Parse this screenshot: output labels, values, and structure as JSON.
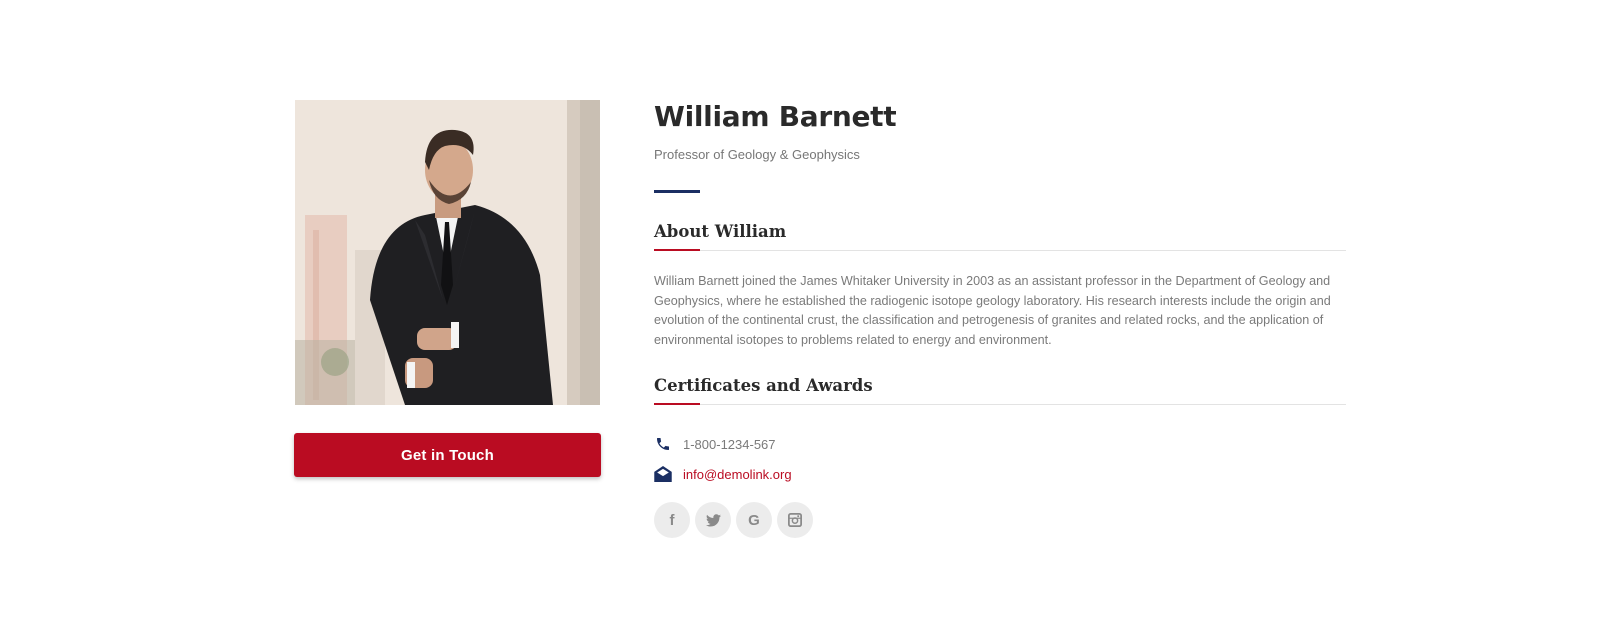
{
  "profile": {
    "name": "William Barnett",
    "role": "Professor of Geology & Geophysics",
    "cta_label": "Get in Touch"
  },
  "about": {
    "title": "About William",
    "text": "William Barnett joined the James Whitaker University in 2003 as an assistant professor in the Department of Geology and Geophysics, where he established the radiogenic isotope geology laboratory. His research interests include the origin and evolution of the continental crust, the classification and petrogenesis of granites and related rocks, and the application of environmental isotopes to problems related to energy and environment."
  },
  "certificates": {
    "title": "Certificates and Awards"
  },
  "contact": {
    "phone": "1-800-1234-567",
    "email": "info@demolink.org",
    "phone_icon": "phone-icon",
    "email_icon": "envelope-open-icon"
  },
  "socials": [
    {
      "icon": "facebook-icon",
      "glyph": "f"
    },
    {
      "icon": "twitter-icon",
      "glyph": "🐦"
    },
    {
      "icon": "google-icon",
      "glyph": "G"
    },
    {
      "icon": "instagram-icon",
      "glyph": "◻"
    }
  ],
  "colors": {
    "accent_red": "#ba0c22",
    "accent_navy": "#1b2f63",
    "text_dark": "#2a2a2a",
    "text_muted": "#7a7a7a",
    "social_bg": "#ececec"
  }
}
